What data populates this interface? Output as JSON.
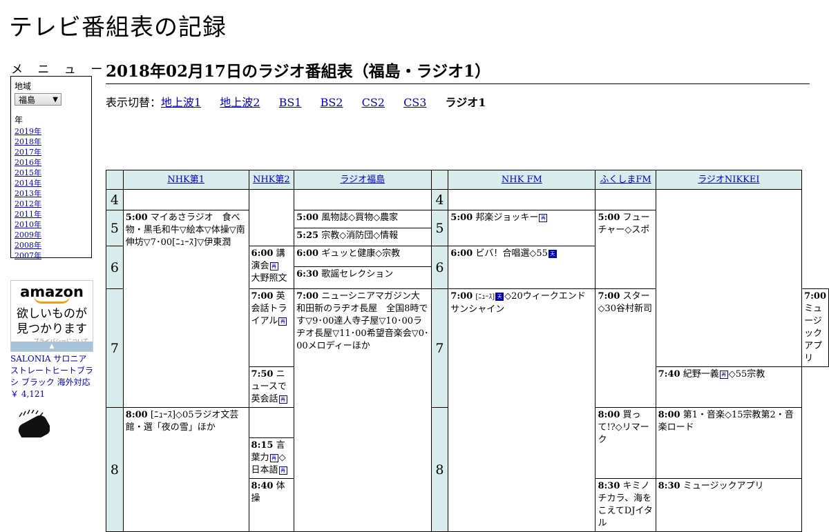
{
  "site": {
    "title": "テレビ番組表の記録"
  },
  "menu": {
    "heading": "メ ニ ュ ー",
    "region_label": "地域",
    "region_value": "福島",
    "year_label": "年",
    "years": [
      "2019年",
      "2018年",
      "2017年",
      "2016年",
      "2015年",
      "2014年",
      "2013年",
      "2012年",
      "2011年",
      "2010年",
      "2009年",
      "2008年",
      "2007年"
    ]
  },
  "ad": {
    "logo": "amazon",
    "tagline_1": "欲しいものが",
    "tagline_2": "見つかります",
    "privacy": "プライバシーについて",
    "product_name": "SALONIA サロニア ストレートヒートブラシ ブラック 海外対応",
    "product_price": "￥ 4,121"
  },
  "page": {
    "title": "2018年02月17日のラジオ番組表（福島・ラジオ1）",
    "switch_label": "表示切替：",
    "tabs": [
      "地上波1",
      "地上波2",
      "BS1",
      "BS2",
      "CS2",
      "CS3"
    ],
    "current_tab": "ラジオ1"
  },
  "schedule": {
    "channels": [
      "NHK第1",
      "NHK第2",
      "ラジオ福島",
      "NHK FM",
      "ふくしまFM",
      "ラジオNIKKEI"
    ],
    "hours": [
      "4",
      "5",
      "6",
      "7",
      "8"
    ],
    "programs": {
      "nhk1_500_time": "5:00",
      "nhk1_500_title": "マイあさラジオ　食べ物・黒毛和牛▽絵本▽体操▽南伸坊▽7･00[ﾆｭｰｽ]▽伊東潤",
      "nhk1_800_time": "8:00",
      "nhk1_800_title": "[ﾆｭｰｽ]◇05ラジオ文芸館・選「夜の雪」ほか",
      "nhk2_600_time": "6:00",
      "nhk2_600_title": "講演会",
      "nhk2_600_tail": "大野照文",
      "nhk2_700_time": "7:00",
      "nhk2_700_title": "英会話トライアル",
      "nhk2_750_time": "7:50",
      "nhk2_750_title": "ニュースで英会話",
      "nhk2_815_time": "8:15",
      "nhk2_815_title": "言葉力",
      "nhk2_815_tail": "◇日本語",
      "nhk2_840_time": "8:40",
      "nhk2_840_title": "体操",
      "rf_500_time": "5:00",
      "rf_500_title": "風物誌◇買物◇農家",
      "rf_525_time": "5:25",
      "rf_525_title": "宗教◇消防団◇情報",
      "rf_600_time": "6:00",
      "rf_600_title": "ギュッと健康◇宗教",
      "rf_630_time": "6:30",
      "rf_630_title": "歌謡セレクション",
      "rf_700_time": "7:00",
      "rf_700_title": "ニューシニアマガジン大和田新のラヂオ長屋　全国8時です▽9･00達人寺子屋▽10･00ラヂオ長屋▽11･00希望音楽会▽0･00メロディーほか",
      "fm_500_time": "5:00",
      "fm_500_title": "邦楽ジョッキー",
      "fm_600_time": "6:00",
      "fm_600_title": "ビバ！合唱選◇55",
      "fm_700_time": "7:00",
      "fm_700_pre": "[ﾆｭｰｽ]",
      "fm_700_title": "◇20ウィークエンドサンシャイン",
      "ff_500_time": "5:00",
      "ff_500_title": "フューチャー◇スポ",
      "ff_700_time": "7:00",
      "ff_700_title": "スター◇30谷村新司",
      "ff_800_time": "8:00",
      "ff_800_title": "買って!?◇リマーク",
      "ff_830_time": "8:30",
      "ff_830_title": "キミノチカラ、海をこえてDJイタル",
      "nk_700_time": "7:00",
      "nk_700_title": "ミュージックアプリ",
      "nk_740_time": "7:40",
      "nk_740_title": "紀野一義",
      "nk_740_tail": "◇55宗教",
      "nk_800_time": "8:00",
      "nk_800_title": "第1・音楽◇15宗教第2・音楽ロード",
      "nk_830_time": "8:30",
      "nk_830_title": "ミュージックアプリ"
    }
  },
  "colors": {
    "header_bg": "#d8ecec",
    "link": "#0000cc"
  }
}
